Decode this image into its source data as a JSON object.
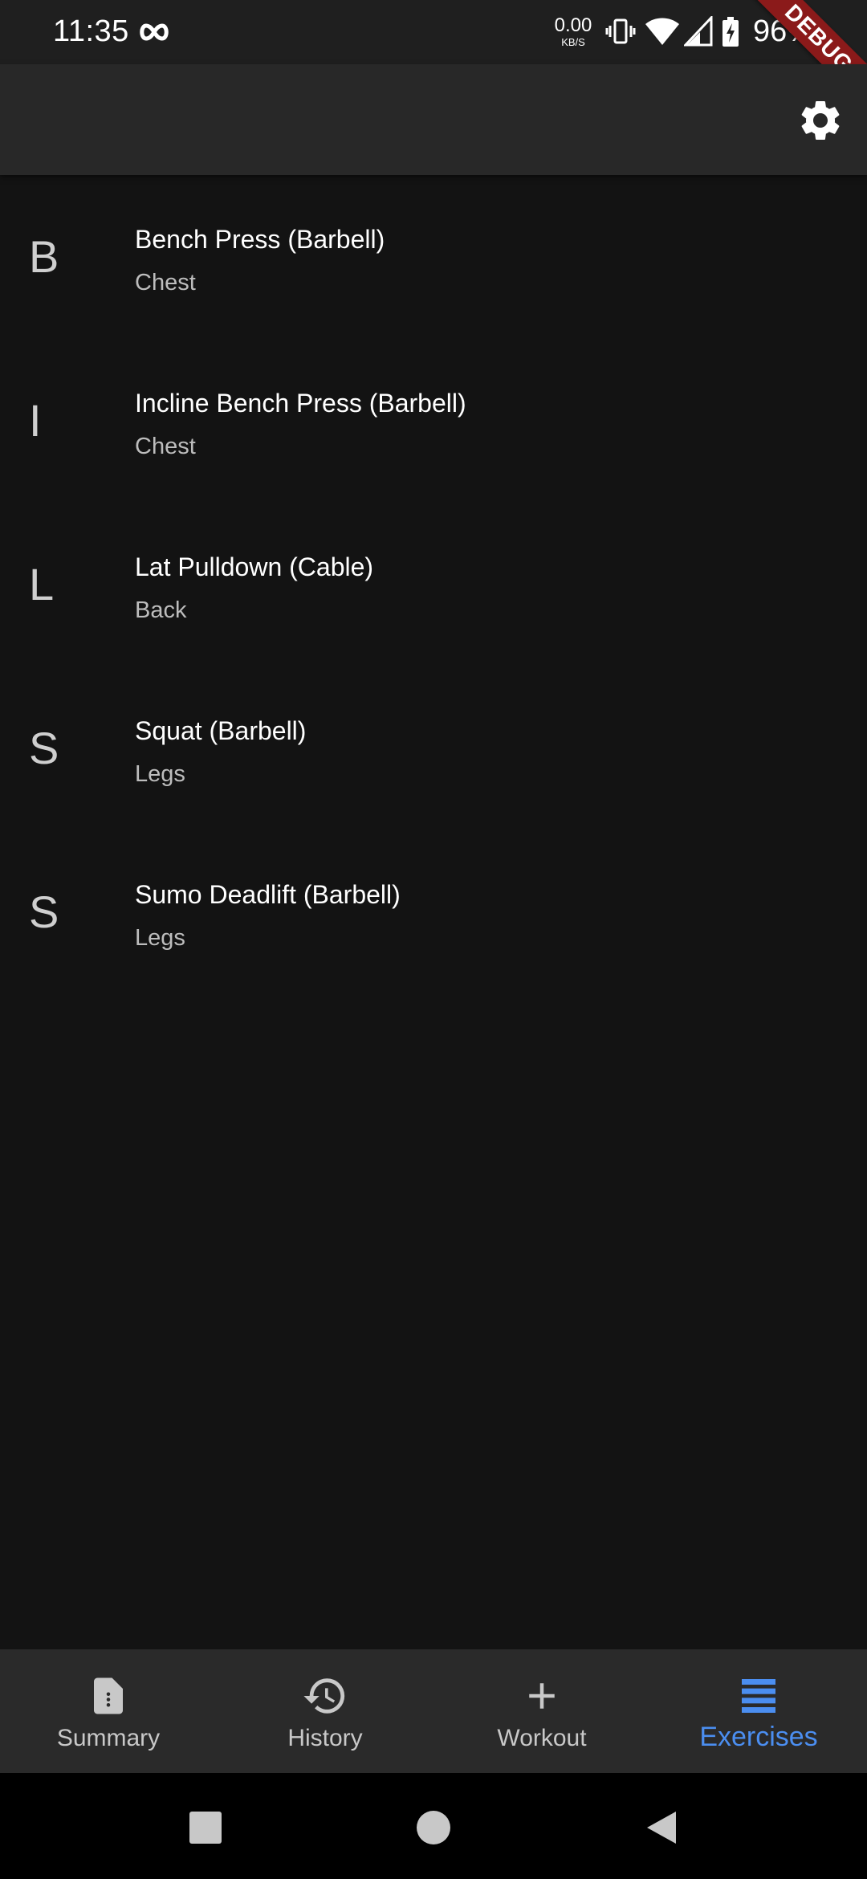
{
  "status_bar": {
    "time": "11:35",
    "net_speed_value": "0.00",
    "net_speed_unit": "KB/S",
    "battery": "96%"
  },
  "debug_banner": "DEBUG",
  "exercises": [
    {
      "letter": "B",
      "name": "Bench Press (Barbell)",
      "category": "Chest"
    },
    {
      "letter": "I",
      "name": "Incline Bench Press (Barbell)",
      "category": "Chest"
    },
    {
      "letter": "L",
      "name": "Lat Pulldown (Cable)",
      "category": "Back"
    },
    {
      "letter": "S",
      "name": "Squat (Barbell)",
      "category": "Legs"
    },
    {
      "letter": "S",
      "name": "Sumo Deadlift (Barbell)",
      "category": "Legs"
    }
  ],
  "bottom_nav": {
    "items": [
      {
        "label": "Summary",
        "icon": "document-icon",
        "active": false
      },
      {
        "label": "History",
        "icon": "history-icon",
        "active": false
      },
      {
        "label": "Workout",
        "icon": "plus-icon",
        "active": false
      },
      {
        "label": "Exercises",
        "icon": "list-icon",
        "active": true
      }
    ]
  },
  "colors": {
    "background": "#131313",
    "app_bar": "#282828",
    "bottom_nav": "#2a2a2a",
    "accent": "#4b8ef0",
    "debug_banner": "#8b1a1a"
  }
}
